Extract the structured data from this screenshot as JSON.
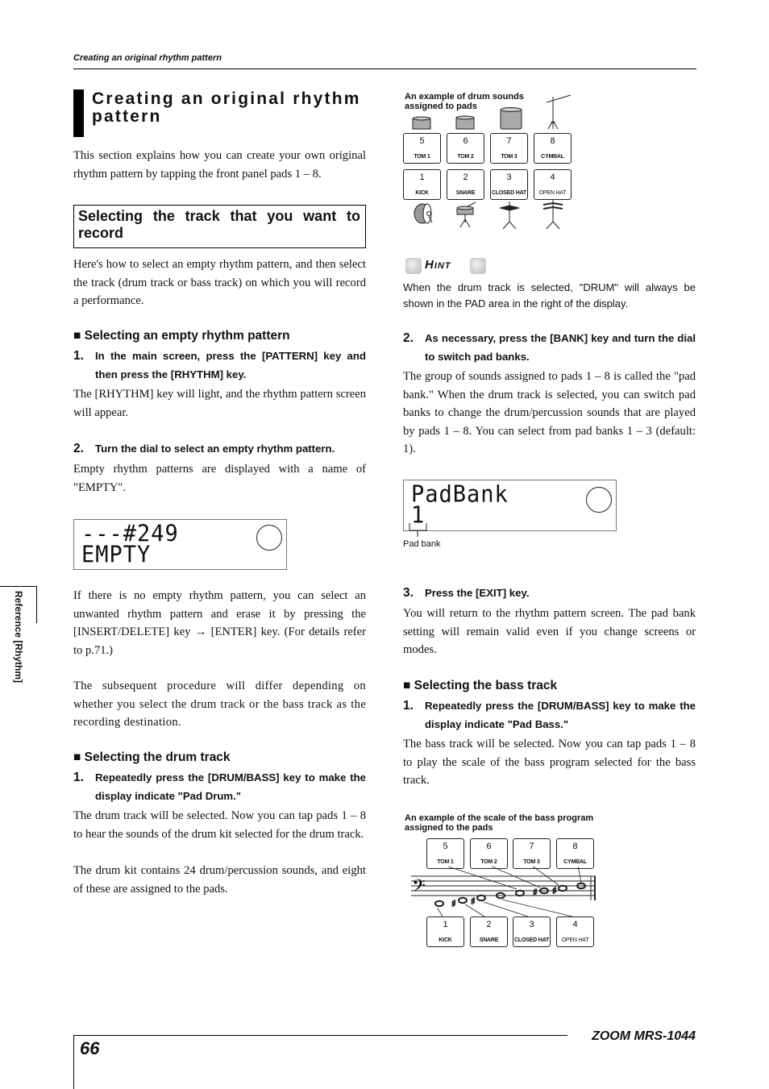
{
  "running_head": "Creating an original rhythm pattern",
  "title": "Creating an original rhythm pattern",
  "intro": "This section explains how you can create your own original rhythm pattern by tapping the front panel pads 1 – 8.",
  "subsection": {
    "title": "Selecting the track that you want to record",
    "intro": "Here's how to select an empty rhythm pattern, and then select the track (drum track or bass track) on which you will record a performance."
  },
  "empty_pattern": {
    "heading": "■ Selecting an empty rhythm pattern",
    "steps": [
      {
        "num": "1.",
        "text": "In the main screen, press the [PATTERN] key and then press the [RHYTHM] key.",
        "body": "The [RHYTHM] key will light, and the rhythm pattern screen will appear."
      },
      {
        "num": "2.",
        "text": "Turn the dial to select an empty rhythm pattern.",
        "body": "Empty rhythm patterns are displayed with a name of \"EMPTY\"."
      }
    ],
    "lcd": {
      "line1": "---#249",
      "line2": "EMPTY"
    },
    "note1": "If there is no empty rhythm pattern, you can select an unwanted rhythm pattern and erase it by pressing the [INSERT/DELETE] key → [ENTER] key. (For details refer to p.71.)",
    "note2": "The subsequent procedure will differ depending on whether you select the drum track or the bass track as the recording destination."
  },
  "drum_track": {
    "heading": "■ Selecting the drum track",
    "step1": {
      "num": "1.",
      "text": "Repeatedly press the [DRUM/BASS] key to make the display indicate \"Pad Drum.\""
    },
    "body1": "The drum track will be selected. Now you can tap pads 1 – 8 to hear the sounds of the drum kit selected for the drum track.",
    "body2": "The drum kit contains 24 drum/percussion sounds, and eight of these are assigned to the pads."
  },
  "drum_figure": {
    "caption": "An example of drum sounds assigned to pads",
    "pads": [
      {
        "n": "5",
        "label": "TOM 1"
      },
      {
        "n": "6",
        "label": "TOM 2"
      },
      {
        "n": "7",
        "label": "TOM 3"
      },
      {
        "n": "8",
        "label": "CYMBAL"
      },
      {
        "n": "1",
        "label": "KICK"
      },
      {
        "n": "2",
        "label": "SNARE"
      },
      {
        "n": "3",
        "label": "CLOSED HAT"
      },
      {
        "n": "4",
        "label": "OPEN HAT"
      }
    ]
  },
  "hint": {
    "label": "Hint",
    "text": "When the drum track is selected, \"DRUM\" will always be shown in the PAD area in the right of the display."
  },
  "bank_step": {
    "step2": {
      "num": "2.",
      "text": "As necessary, press the [BANK] key and turn the dial to switch pad banks."
    },
    "body": "The group of sounds assigned to pads 1 – 8 is called the \"pad bank.\" When the drum track is selected, you can switch pad banks to change the drum/percussion sounds that are played by pads 1 – 8. You can select from pad banks 1 – 3 (default: 1).",
    "lcd": {
      "line1": "PadBank",
      "line2": "1"
    },
    "lcd_callout": "Pad bank",
    "step3": {
      "num": "3.",
      "text": "Press the [EXIT] key."
    },
    "body3": "You will return to the rhythm pattern screen. The pad bank setting will remain valid even if you change screens or modes."
  },
  "bass_track": {
    "heading": "■ Selecting the bass track",
    "step1": {
      "num": "1.",
      "text": "Repeatedly press the [DRUM/BASS] key to make the display indicate \"Pad Bass.\""
    },
    "body": "The bass track will be selected. Now you can tap pads 1 – 8 to play the scale of the bass program selected for the bass track."
  },
  "bass_figure": {
    "caption": "An example of the scale of the bass program assigned to the pads",
    "pads": [
      {
        "n": "5",
        "label": "TOM 1"
      },
      {
        "n": "6",
        "label": "TOM 2"
      },
      {
        "n": "7",
        "label": "TOM 3"
      },
      {
        "n": "8",
        "label": "CYMBAL"
      },
      {
        "n": "1",
        "label": "KICK"
      },
      {
        "n": "2",
        "label": "SNARE"
      },
      {
        "n": "3",
        "label": "CLOSED HAT"
      },
      {
        "n": "4",
        "label": "OPEN HAT"
      }
    ]
  },
  "side_tab": "Reference [Rhythm]",
  "footer": {
    "page": "66",
    "brand": "ZOOM MRS-1044"
  }
}
